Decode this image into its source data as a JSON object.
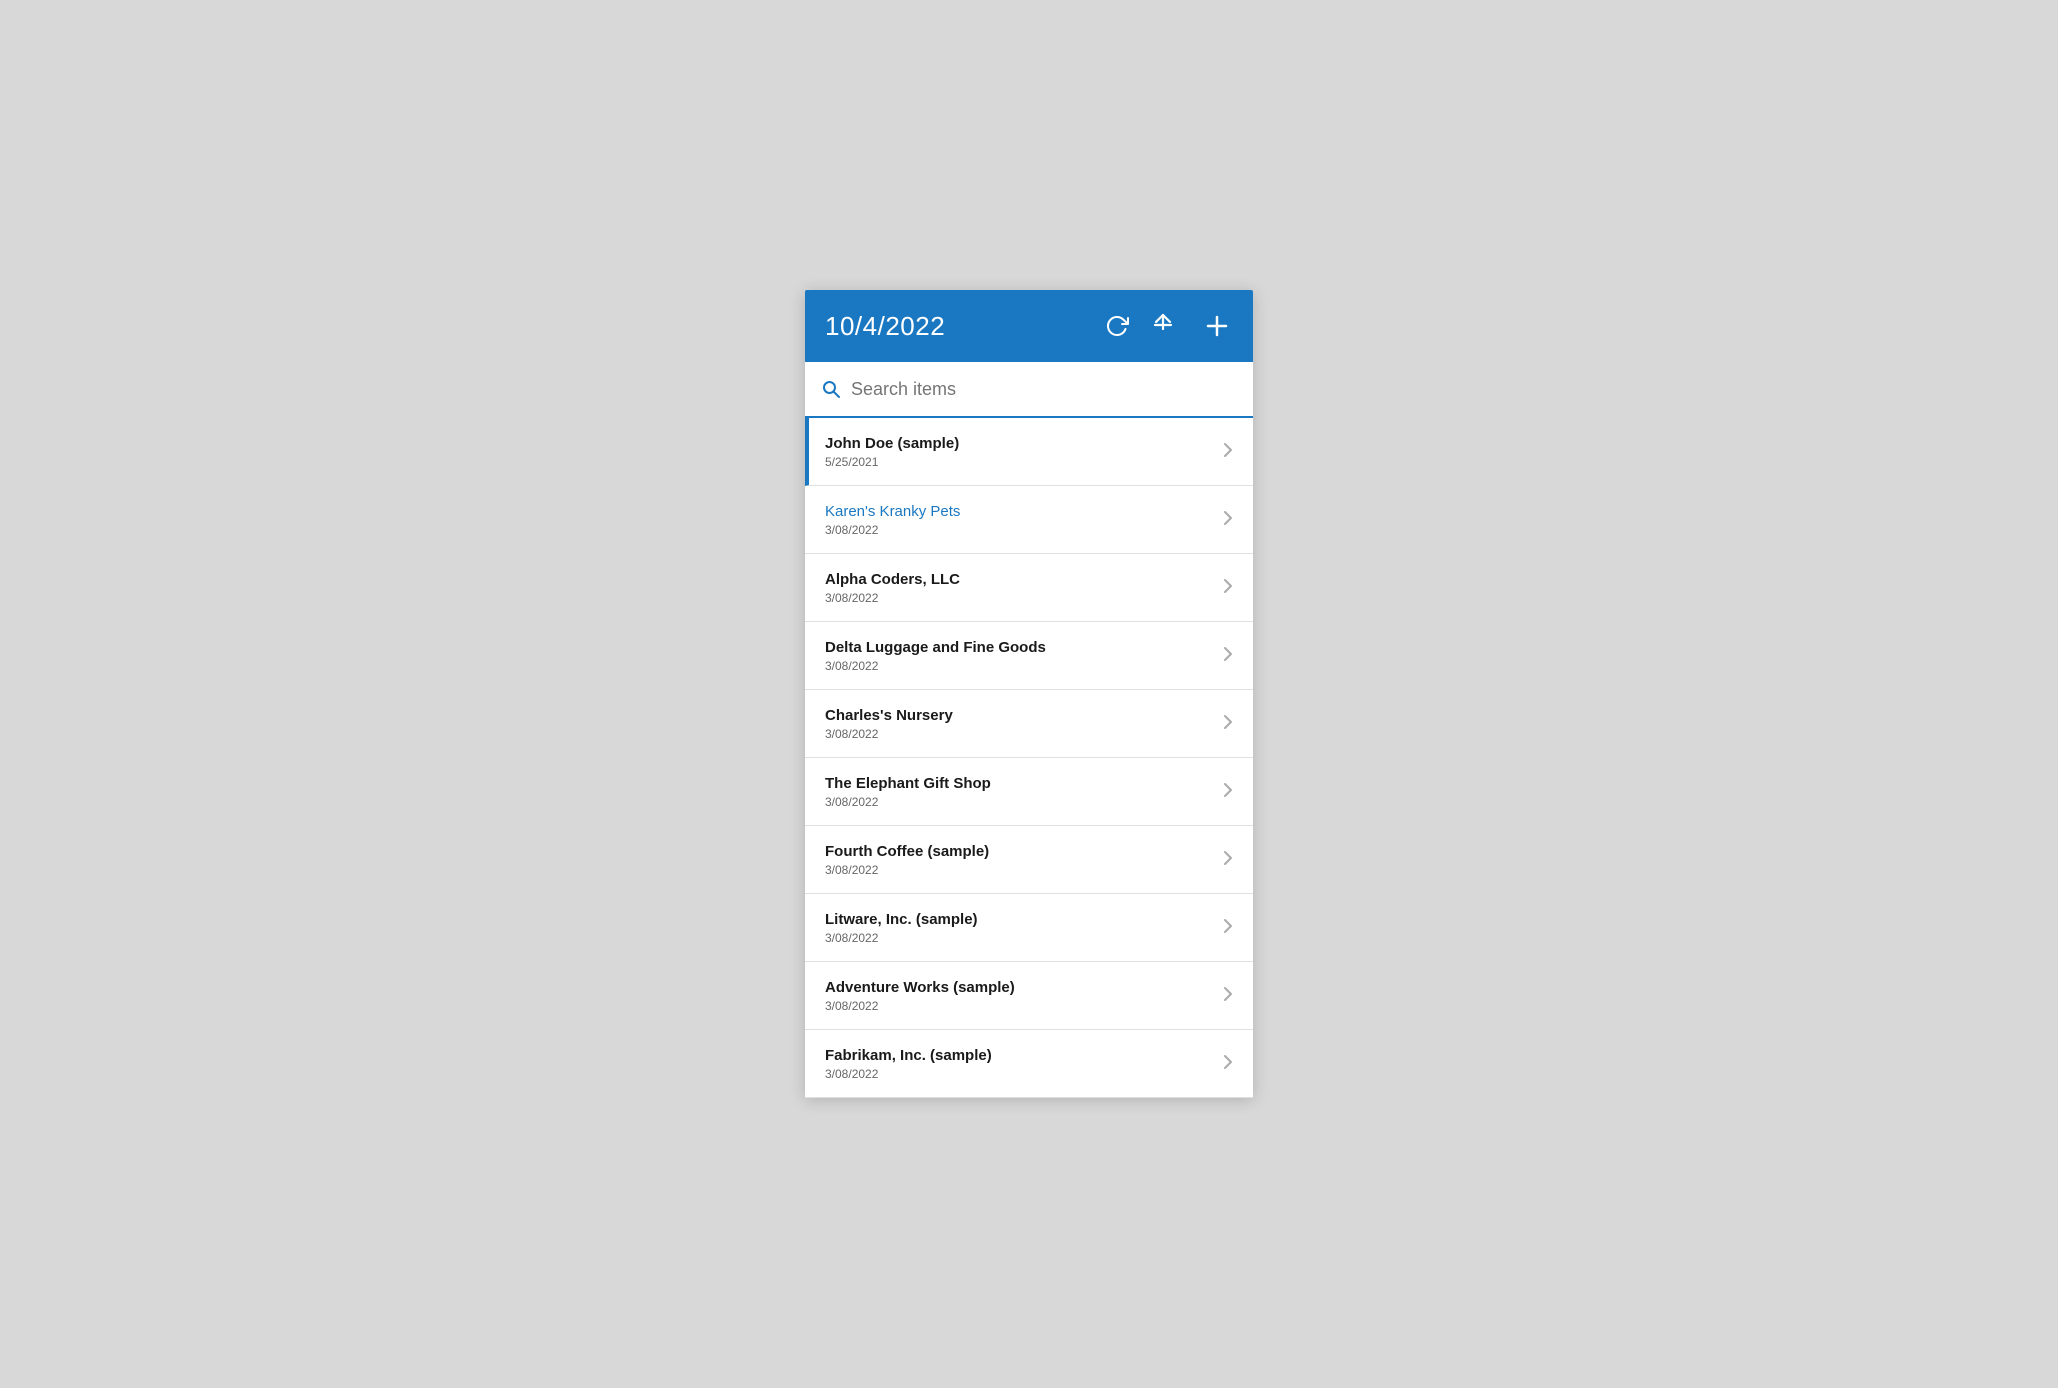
{
  "header": {
    "title": "10/4/2022",
    "refresh_label": "↺",
    "sort_label": "⇅",
    "add_label": "+"
  },
  "search": {
    "placeholder": "Search items"
  },
  "items": [
    {
      "name": "John Doe (sample)",
      "date": "5/25/2021",
      "selected": true,
      "blue": false
    },
    {
      "name": "Karen's Kranky Pets",
      "date": "3/08/2022",
      "selected": false,
      "blue": true
    },
    {
      "name": "Alpha Coders, LLC",
      "date": "3/08/2022",
      "selected": false,
      "blue": false
    },
    {
      "name": "Delta Luggage and Fine Goods",
      "date": "3/08/2022",
      "selected": false,
      "blue": false
    },
    {
      "name": "Charles's Nursery",
      "date": "3/08/2022",
      "selected": false,
      "blue": false
    },
    {
      "name": "The Elephant Gift Shop",
      "date": "3/08/2022",
      "selected": false,
      "blue": false
    },
    {
      "name": "Fourth Coffee (sample)",
      "date": "3/08/2022",
      "selected": false,
      "blue": false
    },
    {
      "name": "Litware, Inc. (sample)",
      "date": "3/08/2022",
      "selected": false,
      "blue": false
    },
    {
      "name": "Adventure Works (sample)",
      "date": "3/08/2022",
      "selected": false,
      "blue": false
    },
    {
      "name": "Fabrikam, Inc. (sample)",
      "date": "3/08/2022",
      "selected": false,
      "blue": false
    }
  ]
}
